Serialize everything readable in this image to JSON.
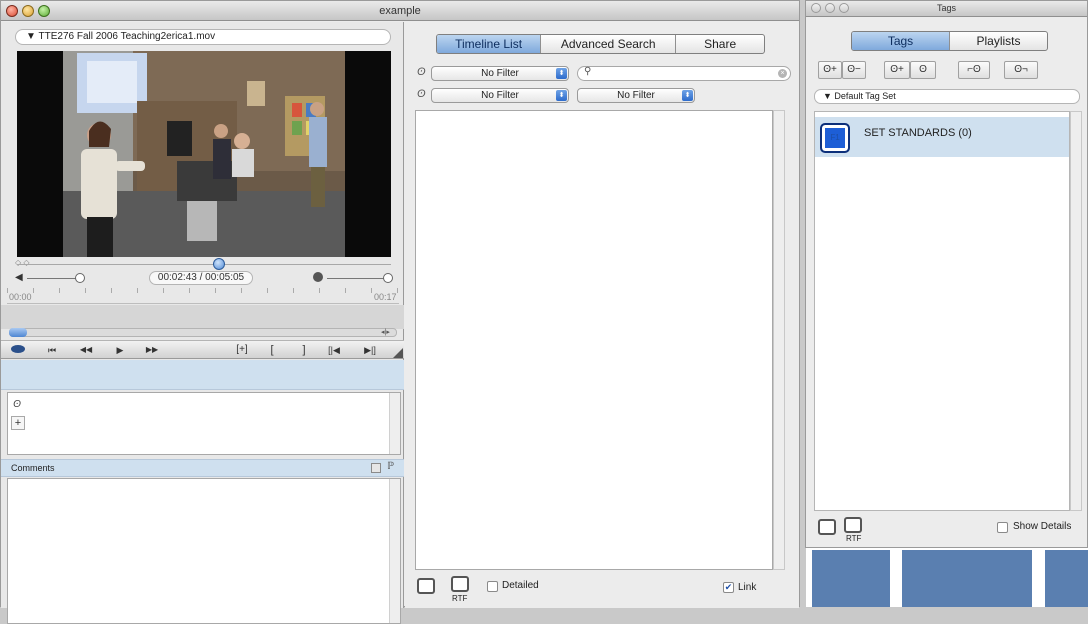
{
  "main_window": {
    "title": "example",
    "media_title": "TTE276 Fall 2006 Teaching2erica1.mov",
    "timecode": "00:02:43 / 00:05:05",
    "ruler_start": "00:00",
    "ruler_end": "00:17",
    "transport": [
      "⏮",
      "◀◀",
      "▶",
      "▶▶",
      "[+]",
      "[",
      "]",
      "[|◀",
      "▶|]"
    ],
    "comments_label": "Comments",
    "tabs": [
      {
        "label": "Timeline List",
        "selected": true
      },
      {
        "label": "Advanced Search",
        "selected": false
      },
      {
        "label": "Share",
        "selected": false
      }
    ],
    "filter1": "No Filter",
    "filter2": "No Filter",
    "filter3": "No Filter",
    "detailed_label": "Detailed",
    "link_label": "Link",
    "print_rtf_label": "RTF"
  },
  "tags_window": {
    "title": "Tags",
    "tabs": [
      {
        "label": "Tags",
        "selected": true
      },
      {
        "label": "Playlists",
        "selected": false
      }
    ],
    "tag_set": "Default Tag Set",
    "tag_items": [
      {
        "key": "F1",
        "name": "SET STANDARDS (0)"
      }
    ],
    "show_details_label": "Show Details",
    "print_rtf_label": "RTF"
  },
  "colors": {
    "selection": "#cfe0ef",
    "accent": "#1d5ed6"
  }
}
